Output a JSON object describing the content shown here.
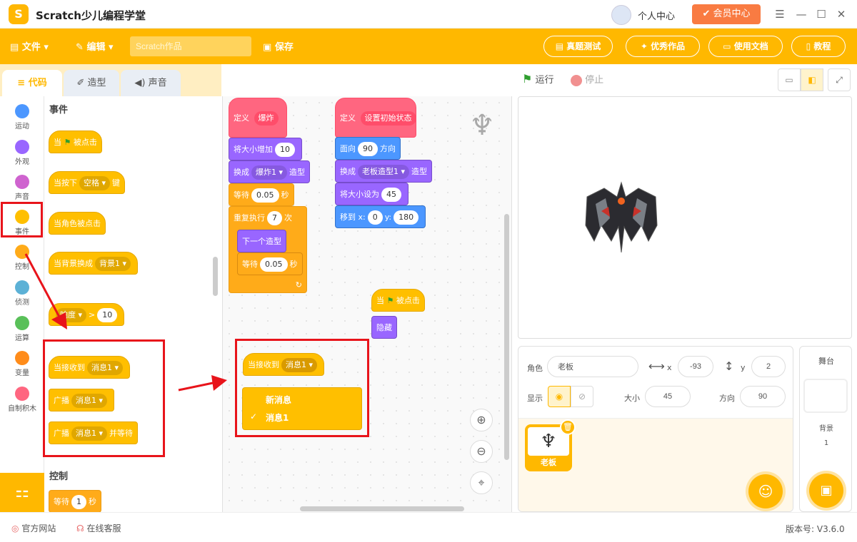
{
  "app": {
    "title": "Scratch少儿编程学堂",
    "logo_char": "S",
    "personal_label": "个人中心",
    "vip_label": "会员中心"
  },
  "toolbar": {
    "file_label": "文件",
    "edit_label": "编辑",
    "search_placeholder": "Scratch作品",
    "save_label": "保存",
    "buttons": [
      "真题测试",
      "优秀作品",
      "使用文档",
      "教程"
    ]
  },
  "tabs": [
    {
      "label": "代码"
    },
    {
      "label": "造型"
    },
    {
      "label": "声音"
    }
  ],
  "categories": [
    {
      "label": "运动",
      "color": "#4c97ff"
    },
    {
      "label": "外观",
      "color": "#9966ff"
    },
    {
      "label": "声音",
      "color": "#cf63cf"
    },
    {
      "label": "事件",
      "color": "#ffbf00"
    },
    {
      "label": "控制",
      "color": "#ffab19"
    },
    {
      "label": "侦测",
      "color": "#5cb1d6"
    },
    {
      "label": "运算",
      "color": "#59c059"
    },
    {
      "label": "变量",
      "color": "#ff8c1a"
    },
    {
      "label": "自制积木",
      "color": "#ff6680"
    }
  ],
  "palette": {
    "events_header": "事件",
    "b_flag_pre": "当",
    "b_flag_post": "被点击",
    "b_key_pre": "当按下",
    "b_key_dd": "空格",
    "b_key_post": "键",
    "b_sprite_click": "当角色被点击",
    "b_backdrop_pre": "当背景换成",
    "b_backdrop_dd": "背景1",
    "b_loud_dd": "响度",
    "b_loud_op": ">",
    "b_loud_val": "10",
    "b_recv_pre": "当接收到",
    "b_recv_dd": "消息1",
    "b_bcast_pre": "广播",
    "b_bcast_dd": "消息1",
    "b_bcastw_pre": "广播",
    "b_bcastw_dd": "消息1",
    "b_bcastw_post": "并等待",
    "control_header": "控制",
    "b_wait_pre": "等待",
    "b_wait_val": "1",
    "b_wait_post": "秒"
  },
  "scripts": {
    "s1": {
      "define": "定义",
      "name": "爆炸",
      "grow_pre": "将大小增加",
      "grow_val": "10",
      "switch_pre": "换成",
      "switch_dd": "爆炸1",
      "switch_post": "造型",
      "wait_pre": "等待",
      "wait_val": "0.05",
      "wait_post": "秒",
      "repeat_pre": "重复执行",
      "repeat_val": "7",
      "repeat_post": "次",
      "next": "下一个造型",
      "wait2_pre": "等待",
      "wait2_val": "0.05",
      "wait2_post": "秒"
    },
    "s2": {
      "define": "定义",
      "name": "设置初始状态",
      "face_pre": "面向",
      "face_val": "90",
      "face_post": "方向",
      "switch_pre": "换成",
      "switch_dd": "老板造型1",
      "switch_post": "造型",
      "size_pre": "将大小设为",
      "size_val": "45",
      "goto_pre": "移到 x:",
      "goto_x": "0",
      "goto_y_label": "y:",
      "goto_y": "180"
    },
    "s3": {
      "flag_pre": "当",
      "flag_post": "被点击",
      "hide": "隐藏"
    },
    "s4": {
      "recv_pre": "当接收到",
      "recv_dd": "消息1",
      "menu": [
        {
          "label": "新消息",
          "checked": false
        },
        {
          "label": "消息1",
          "checked": true
        }
      ],
      "check": "✓"
    }
  },
  "stage_controls": {
    "run": "运行",
    "stop": "停止"
  },
  "sprite_info": {
    "sprite_label": "角色",
    "sprite_name": "老板",
    "x_label": "x",
    "x_val": "-93",
    "y_label": "y",
    "y_val": "2",
    "show_label": "显示",
    "size_label": "大小",
    "size_val": "45",
    "dir_label": "方向",
    "dir_val": "90"
  },
  "sprite_list": [
    {
      "name": "老板"
    }
  ],
  "stage_panel": {
    "title": "舞台",
    "backdrop_label": "背景",
    "backdrop_count": "1"
  },
  "status": {
    "website": "官方网站",
    "service": "在线客服",
    "version": "版本号: V3.6.0"
  },
  "colors": {
    "accent": "#ffb800",
    "highlight": "#e8141b",
    "vip": "#f97b42"
  }
}
